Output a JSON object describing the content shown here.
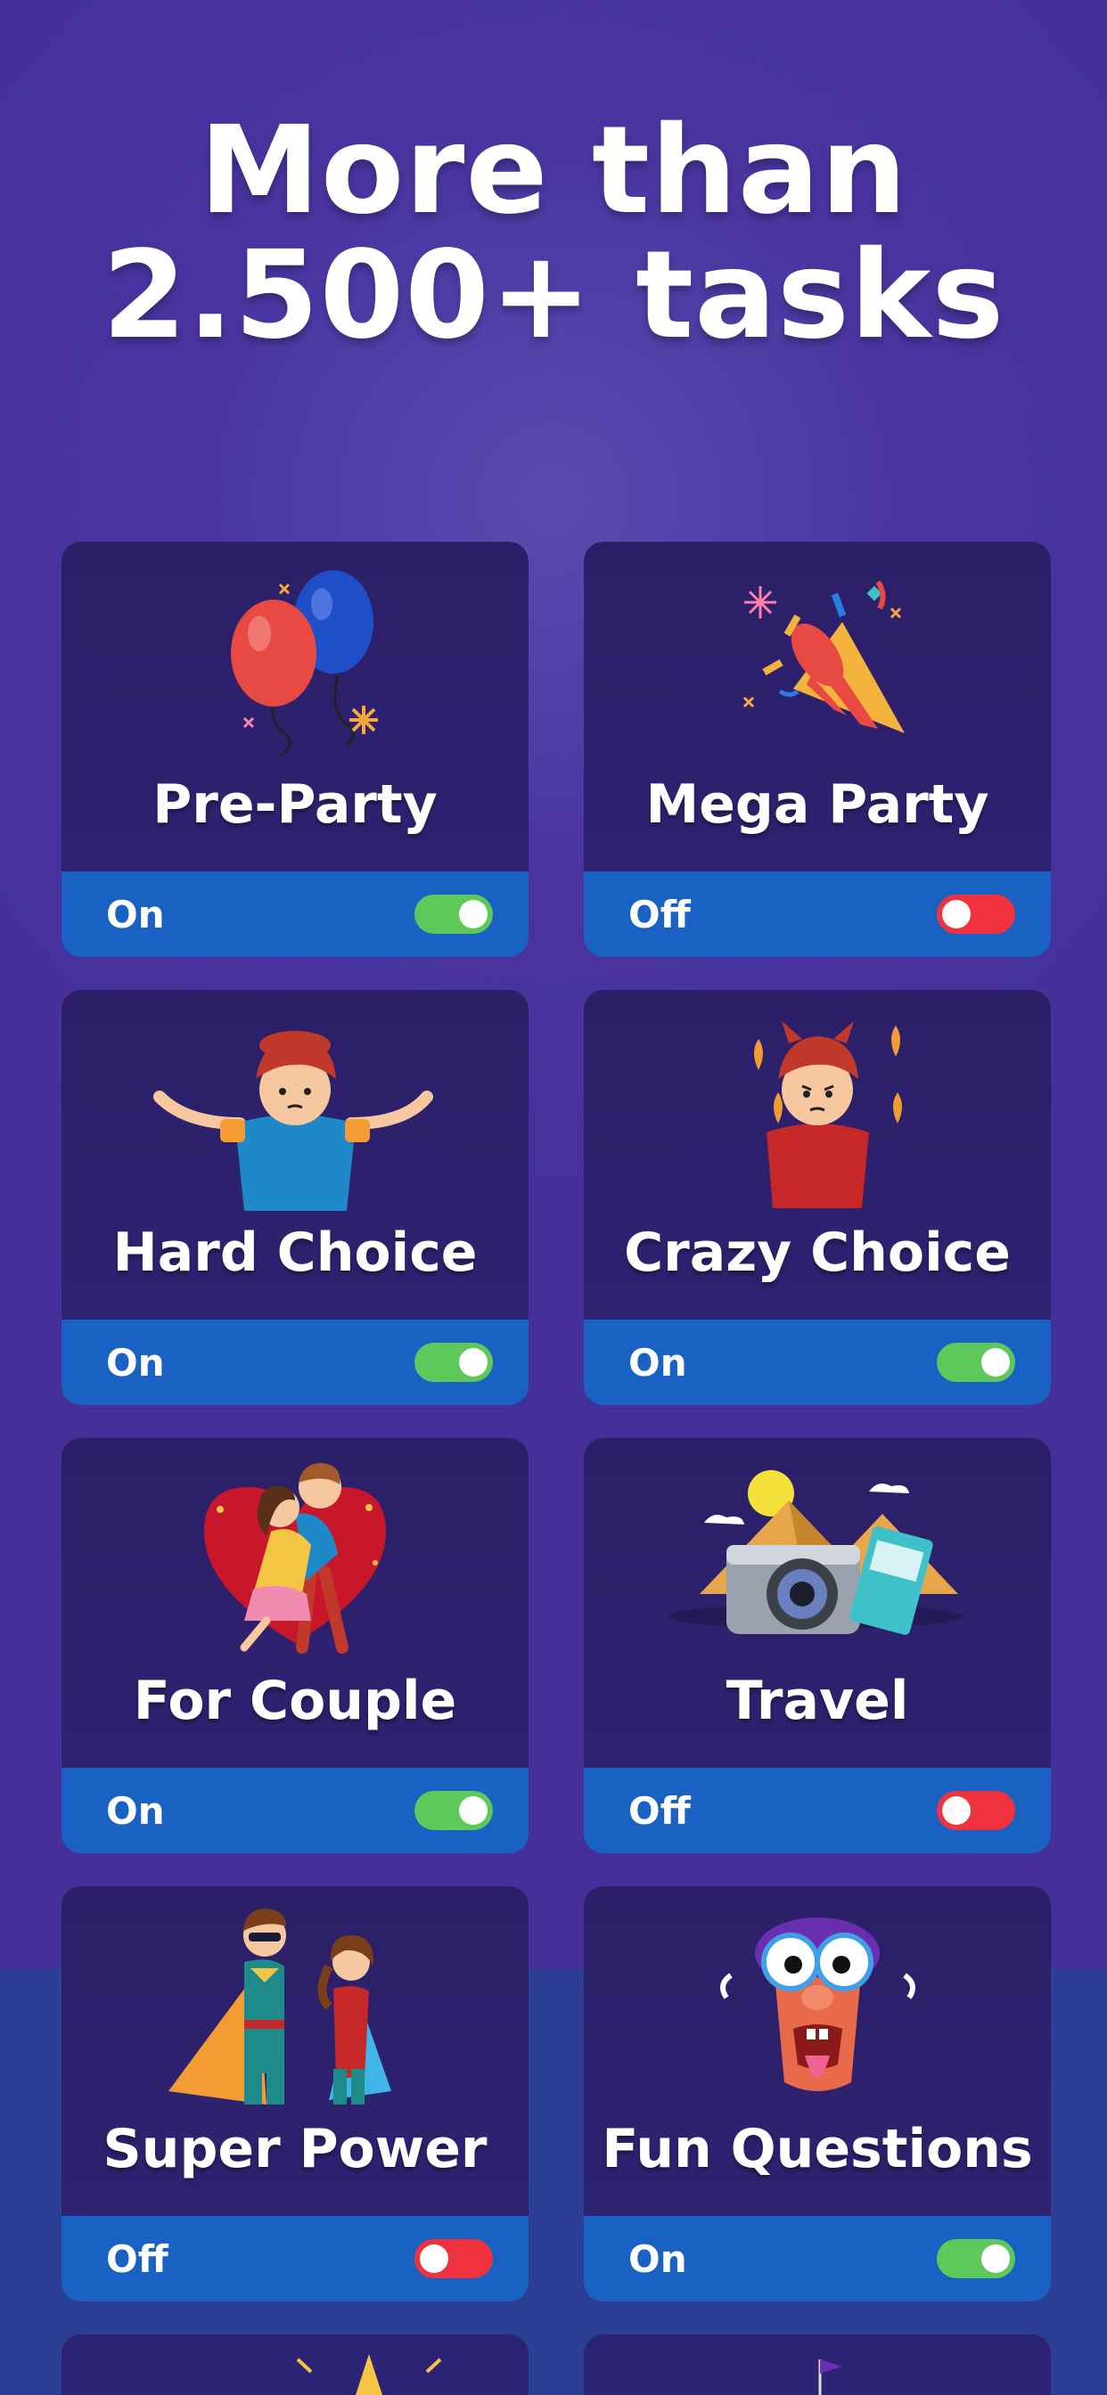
{
  "header": {
    "title_line1": "More than",
    "title_line2": "2.500+ tasks"
  },
  "colors": {
    "toggle_on": "#5ec95a",
    "toggle_off": "#f0323e",
    "footer": "#1962c4",
    "background": "#4a35a0"
  },
  "cards": [
    {
      "title": "Pre-Party",
      "state": "On",
      "icon": "balloons-icon"
    },
    {
      "title": "Mega Party",
      "state": "Off",
      "icon": "party-popper-icon"
    },
    {
      "title": "Hard Choice",
      "state": "On",
      "icon": "shrugging-boy-icon"
    },
    {
      "title": "Crazy Choice",
      "state": "On",
      "icon": "devil-boy-icon"
    },
    {
      "title": "For Couple",
      "state": "On",
      "icon": "couple-heart-icon"
    },
    {
      "title": "Travel",
      "state": "Off",
      "icon": "travel-camera-icon"
    },
    {
      "title": "Super Power",
      "state": "Off",
      "icon": "superheroes-icon"
    },
    {
      "title": "Fun Questions",
      "state": "On",
      "icon": "funny-face-icon"
    }
  ]
}
